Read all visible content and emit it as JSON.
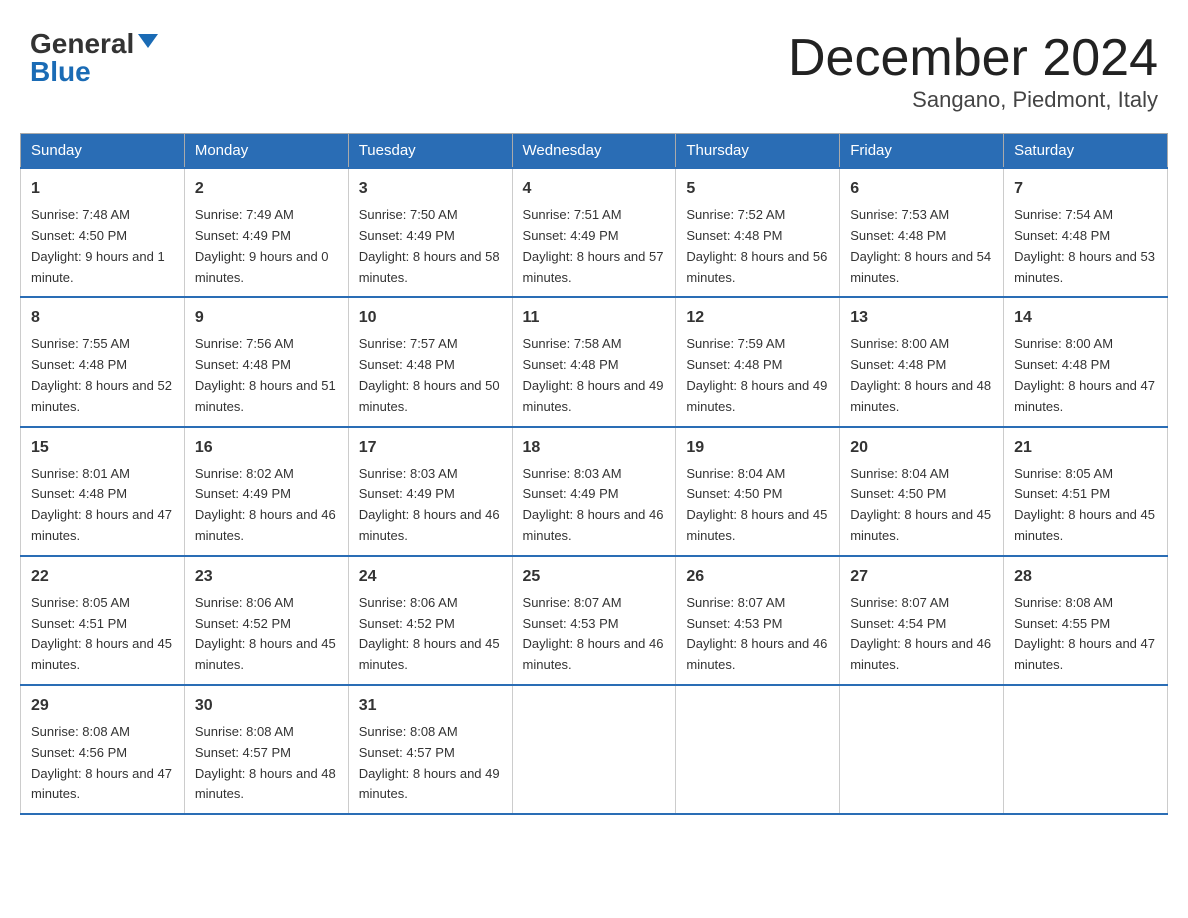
{
  "header": {
    "logo_general": "General",
    "logo_blue": "Blue",
    "month_title": "December 2024",
    "location": "Sangano, Piedmont, Italy"
  },
  "weekdays": [
    "Sunday",
    "Monday",
    "Tuesday",
    "Wednesday",
    "Thursday",
    "Friday",
    "Saturday"
  ],
  "weeks": [
    [
      {
        "day": "1",
        "sunrise": "7:48 AM",
        "sunset": "4:50 PM",
        "daylight": "9 hours and 1 minute."
      },
      {
        "day": "2",
        "sunrise": "7:49 AM",
        "sunset": "4:49 PM",
        "daylight": "9 hours and 0 minutes."
      },
      {
        "day": "3",
        "sunrise": "7:50 AM",
        "sunset": "4:49 PM",
        "daylight": "8 hours and 58 minutes."
      },
      {
        "day": "4",
        "sunrise": "7:51 AM",
        "sunset": "4:49 PM",
        "daylight": "8 hours and 57 minutes."
      },
      {
        "day": "5",
        "sunrise": "7:52 AM",
        "sunset": "4:48 PM",
        "daylight": "8 hours and 56 minutes."
      },
      {
        "day": "6",
        "sunrise": "7:53 AM",
        "sunset": "4:48 PM",
        "daylight": "8 hours and 54 minutes."
      },
      {
        "day": "7",
        "sunrise": "7:54 AM",
        "sunset": "4:48 PM",
        "daylight": "8 hours and 53 minutes."
      }
    ],
    [
      {
        "day": "8",
        "sunrise": "7:55 AM",
        "sunset": "4:48 PM",
        "daylight": "8 hours and 52 minutes."
      },
      {
        "day": "9",
        "sunrise": "7:56 AM",
        "sunset": "4:48 PM",
        "daylight": "8 hours and 51 minutes."
      },
      {
        "day": "10",
        "sunrise": "7:57 AM",
        "sunset": "4:48 PM",
        "daylight": "8 hours and 50 minutes."
      },
      {
        "day": "11",
        "sunrise": "7:58 AM",
        "sunset": "4:48 PM",
        "daylight": "8 hours and 49 minutes."
      },
      {
        "day": "12",
        "sunrise": "7:59 AM",
        "sunset": "4:48 PM",
        "daylight": "8 hours and 49 minutes."
      },
      {
        "day": "13",
        "sunrise": "8:00 AM",
        "sunset": "4:48 PM",
        "daylight": "8 hours and 48 minutes."
      },
      {
        "day": "14",
        "sunrise": "8:00 AM",
        "sunset": "4:48 PM",
        "daylight": "8 hours and 47 minutes."
      }
    ],
    [
      {
        "day": "15",
        "sunrise": "8:01 AM",
        "sunset": "4:48 PM",
        "daylight": "8 hours and 47 minutes."
      },
      {
        "day": "16",
        "sunrise": "8:02 AM",
        "sunset": "4:49 PM",
        "daylight": "8 hours and 46 minutes."
      },
      {
        "day": "17",
        "sunrise": "8:03 AM",
        "sunset": "4:49 PM",
        "daylight": "8 hours and 46 minutes."
      },
      {
        "day": "18",
        "sunrise": "8:03 AM",
        "sunset": "4:49 PM",
        "daylight": "8 hours and 46 minutes."
      },
      {
        "day": "19",
        "sunrise": "8:04 AM",
        "sunset": "4:50 PM",
        "daylight": "8 hours and 45 minutes."
      },
      {
        "day": "20",
        "sunrise": "8:04 AM",
        "sunset": "4:50 PM",
        "daylight": "8 hours and 45 minutes."
      },
      {
        "day": "21",
        "sunrise": "8:05 AM",
        "sunset": "4:51 PM",
        "daylight": "8 hours and 45 minutes."
      }
    ],
    [
      {
        "day": "22",
        "sunrise": "8:05 AM",
        "sunset": "4:51 PM",
        "daylight": "8 hours and 45 minutes."
      },
      {
        "day": "23",
        "sunrise": "8:06 AM",
        "sunset": "4:52 PM",
        "daylight": "8 hours and 45 minutes."
      },
      {
        "day": "24",
        "sunrise": "8:06 AM",
        "sunset": "4:52 PM",
        "daylight": "8 hours and 45 minutes."
      },
      {
        "day": "25",
        "sunrise": "8:07 AM",
        "sunset": "4:53 PM",
        "daylight": "8 hours and 46 minutes."
      },
      {
        "day": "26",
        "sunrise": "8:07 AM",
        "sunset": "4:53 PM",
        "daylight": "8 hours and 46 minutes."
      },
      {
        "day": "27",
        "sunrise": "8:07 AM",
        "sunset": "4:54 PM",
        "daylight": "8 hours and 46 minutes."
      },
      {
        "day": "28",
        "sunrise": "8:08 AM",
        "sunset": "4:55 PM",
        "daylight": "8 hours and 47 minutes."
      }
    ],
    [
      {
        "day": "29",
        "sunrise": "8:08 AM",
        "sunset": "4:56 PM",
        "daylight": "8 hours and 47 minutes."
      },
      {
        "day": "30",
        "sunrise": "8:08 AM",
        "sunset": "4:57 PM",
        "daylight": "8 hours and 48 minutes."
      },
      {
        "day": "31",
        "sunrise": "8:08 AM",
        "sunset": "4:57 PM",
        "daylight": "8 hours and 49 minutes."
      },
      null,
      null,
      null,
      null
    ]
  ]
}
